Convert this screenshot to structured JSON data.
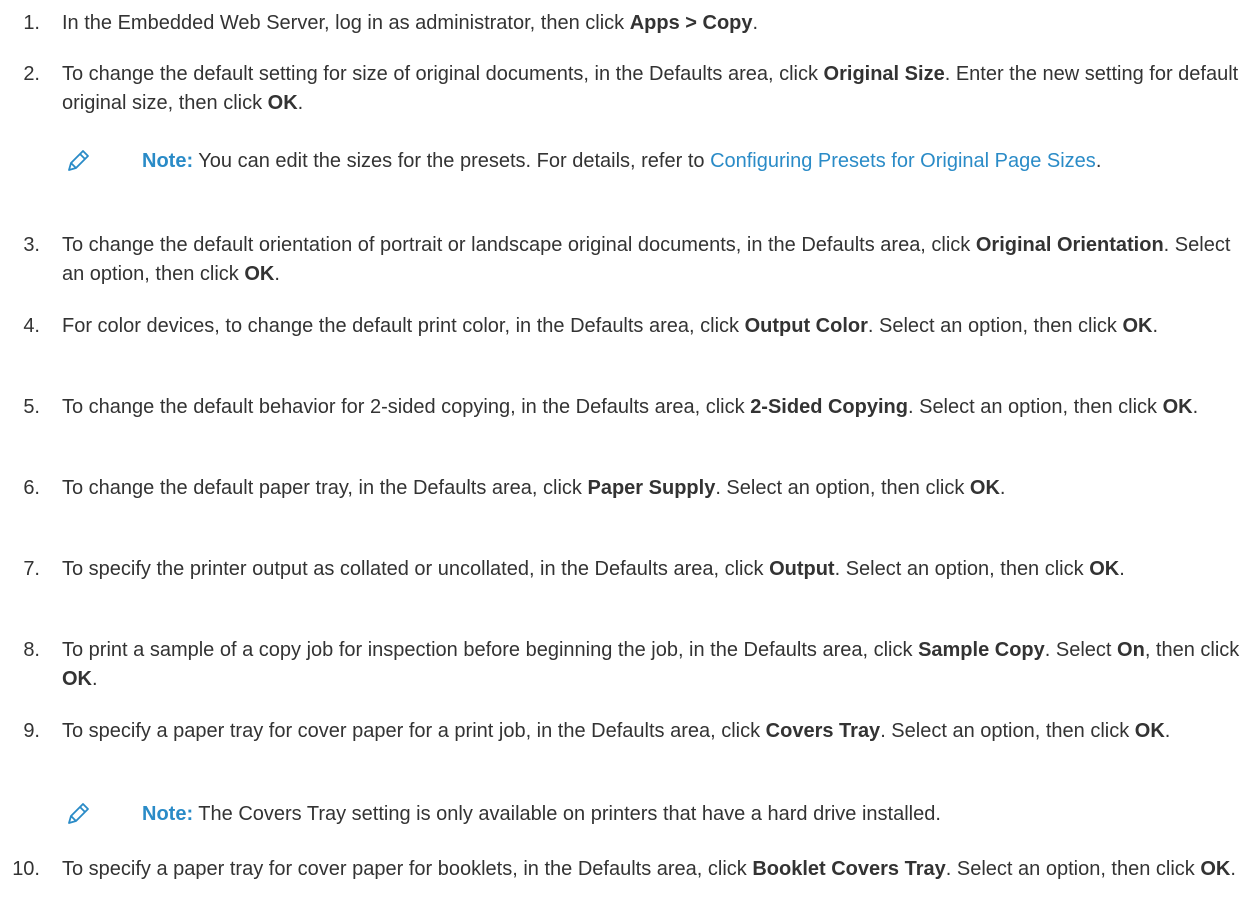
{
  "steps": [
    {
      "num": "1.",
      "parts": [
        {
          "t": "In the Embedded Web Server, log in as administrator, then click "
        },
        {
          "t": "Apps > Copy",
          "b": true
        },
        {
          "t": "."
        }
      ]
    },
    {
      "num": "2.",
      "parts": [
        {
          "t": "To change the default setting for size of original documents, in the Defaults area, click "
        },
        {
          "t": "Original Size",
          "b": true
        },
        {
          "t": ". Enter the new setting for default original size, then click "
        },
        {
          "t": "OK",
          "b": true
        },
        {
          "t": "."
        }
      ]
    },
    {
      "num": "3.",
      "parts": [
        {
          "t": "To change the default orientation of portrait or landscape original documents, in the Defaults area, click "
        },
        {
          "t": "Original Orientation",
          "b": true
        },
        {
          "t": ". Select an option, then click "
        },
        {
          "t": "OK",
          "b": true
        },
        {
          "t": "."
        }
      ]
    },
    {
      "num": "4.",
      "parts": [
        {
          "t": "For color devices, to change the default print color, in the Defaults area, click "
        },
        {
          "t": "Output Color",
          "b": true
        },
        {
          "t": ". Select an option, then click "
        },
        {
          "t": "OK",
          "b": true
        },
        {
          "t": "."
        }
      ]
    },
    {
      "num": "5.",
      "parts": [
        {
          "t": "To change the default behavior for 2-sided copying, in the Defaults area, click "
        },
        {
          "t": "2-Sided Copying",
          "b": true
        },
        {
          "t": ". Select an option, then click "
        },
        {
          "t": "OK",
          "b": true
        },
        {
          "t": "."
        }
      ]
    },
    {
      "num": "6.",
      "parts": [
        {
          "t": "To change the default paper tray, in the Defaults area, click "
        },
        {
          "t": "Paper Supply",
          "b": true
        },
        {
          "t": ". Select an option, then click "
        },
        {
          "t": "OK",
          "b": true
        },
        {
          "t": "."
        }
      ]
    },
    {
      "num": "7.",
      "parts": [
        {
          "t": "To specify the printer output as collated or uncollated, in the Defaults area, click "
        },
        {
          "t": "Output",
          "b": true
        },
        {
          "t": ". Select an option, then click "
        },
        {
          "t": "OK",
          "b": true
        },
        {
          "t": "."
        }
      ]
    },
    {
      "num": "8.",
      "parts": [
        {
          "t": "To print a sample of a copy job for inspection before beginning the job, in the Defaults area, click "
        },
        {
          "t": "Sample Copy",
          "b": true
        },
        {
          "t": ". Select "
        },
        {
          "t": "On",
          "b": true
        },
        {
          "t": ", then click "
        },
        {
          "t": "OK",
          "b": true
        },
        {
          "t": "."
        }
      ]
    },
    {
      "num": "9.",
      "parts": [
        {
          "t": "To specify a paper tray for cover paper for a print job, in the Defaults area, click "
        },
        {
          "t": "Covers Tray",
          "b": true
        },
        {
          "t": ". Select an option, then click "
        },
        {
          "t": "OK",
          "b": true
        },
        {
          "t": "."
        }
      ]
    },
    {
      "num": "10.",
      "parts": [
        {
          "t": "To specify a paper tray for cover paper for booklets, in the Defaults area, click "
        },
        {
          "t": "Booklet Covers Tray",
          "b": true
        },
        {
          "t": ". Select an option, then click "
        },
        {
          "t": "OK",
          "b": true
        },
        {
          "t": "."
        }
      ]
    }
  ],
  "notes": [
    {
      "label": "Note:",
      "text_before": " You can edit the sizes for the presets. For details, refer to ",
      "link": "Configuring Presets for Original Page Sizes",
      "text_after": "."
    },
    {
      "label": "Note:",
      "text_before": " The Covers Tray setting is only available on printers that have a hard drive installed.",
      "link": "",
      "text_after": ""
    }
  ],
  "colors": {
    "text": "#333333",
    "accent": "#2a8bc7"
  },
  "icons": {
    "note": "pencil-icon"
  }
}
